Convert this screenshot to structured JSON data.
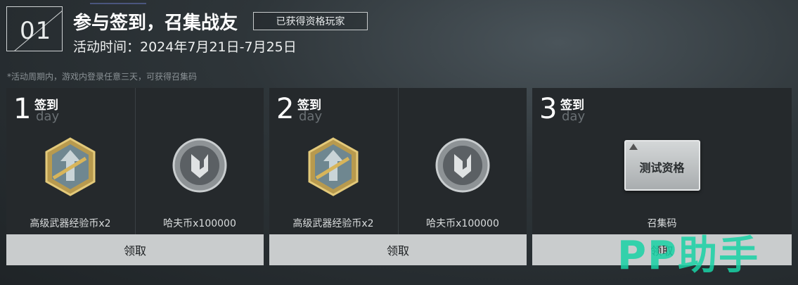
{
  "header": {
    "number": "01",
    "title": "参与签到，召集战友",
    "badge": "已获得资格玩家",
    "time": "活动时间：2024年7月21日-7月25日",
    "note": "*活动周期内，游戏内登录任意三天，可获得召集码"
  },
  "cards": [
    {
      "day": "1",
      "sign": "签到",
      "day_word": "day",
      "rewards": [
        {
          "label": "高级武器经验币x2",
          "icon": "weapon-exp-coin-icon"
        },
        {
          "label": "哈夫币x100000",
          "icon": "haf-coin-icon"
        }
      ],
      "claim": "领取"
    },
    {
      "day": "2",
      "sign": "签到",
      "day_word": "day",
      "rewards": [
        {
          "label": "高级武器经验币x2",
          "icon": "weapon-exp-coin-icon"
        },
        {
          "label": "哈夫币x100000",
          "icon": "haf-coin-icon"
        }
      ],
      "claim": "领取"
    },
    {
      "day": "3",
      "sign": "签到",
      "day_word": "day",
      "rewards": [
        {
          "label": "召集码",
          "icon": "test-qualification-card-icon",
          "card_text": "测试资格"
        }
      ],
      "claim": "领取"
    }
  ],
  "watermark": "PP助手",
  "colors": {
    "accent": "#19d3a6",
    "button": "#c9cccd",
    "card": "#25292c"
  }
}
